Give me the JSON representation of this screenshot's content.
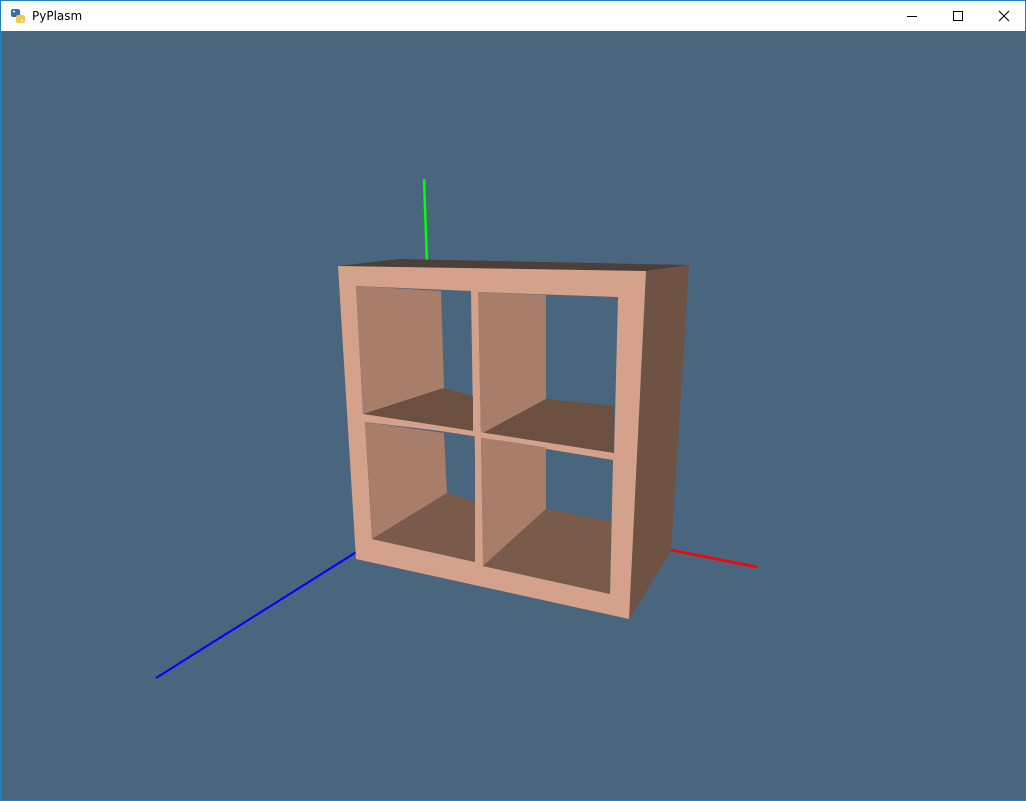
{
  "window": {
    "title": "PyPlasm",
    "controls": {
      "minimize": "minimize",
      "maximize": "maximize",
      "close": "close"
    }
  },
  "scene": {
    "background_color": "#4a657e",
    "object": "cube-bookshelf-2x2",
    "axes": {
      "x_color": "#ff0000",
      "y_color": "#00ff00",
      "z_color": "#0000ff"
    },
    "colors": {
      "front_frame": "#d4a18a",
      "side_panel": "#6e5244",
      "top_panel": "#4d3f37",
      "interior_wall_light": "#b0806c",
      "interior_floor": "#7a5a4a"
    }
  }
}
